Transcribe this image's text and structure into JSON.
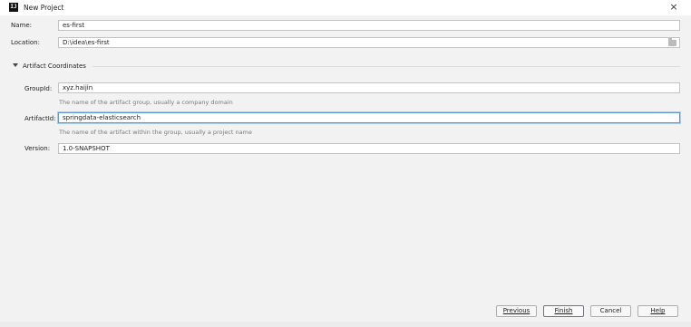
{
  "window": {
    "title": "New Project",
    "close_glyph": "×",
    "app_icon_text": "IJ"
  },
  "form": {
    "name_label": "Name:",
    "name_value": "es-first",
    "location_label": "Location:",
    "location_value": "D:\\idea\\es-first"
  },
  "artifact": {
    "section_title": "Artifact Coordinates",
    "groupid_label": "GroupId:",
    "groupid_value": "xyz.haijin",
    "groupid_hint": "The name of the artifact group, usually a company domain",
    "artifactid_label": "ArtifactId:",
    "artifactid_value": "springdata-elasticsearch",
    "artifactid_hint": "The name of the artifact within the group, usually a project name",
    "version_label": "Version:",
    "version_value": "1.0-SNAPSHOT"
  },
  "buttons": {
    "previous": "Previous",
    "finish": "Finish",
    "cancel": "Cancel",
    "help": "Help"
  },
  "icons": [
    "intellij-app-icon",
    "close-icon",
    "folder-browse-icon",
    "collapse-triangle-icon"
  ]
}
